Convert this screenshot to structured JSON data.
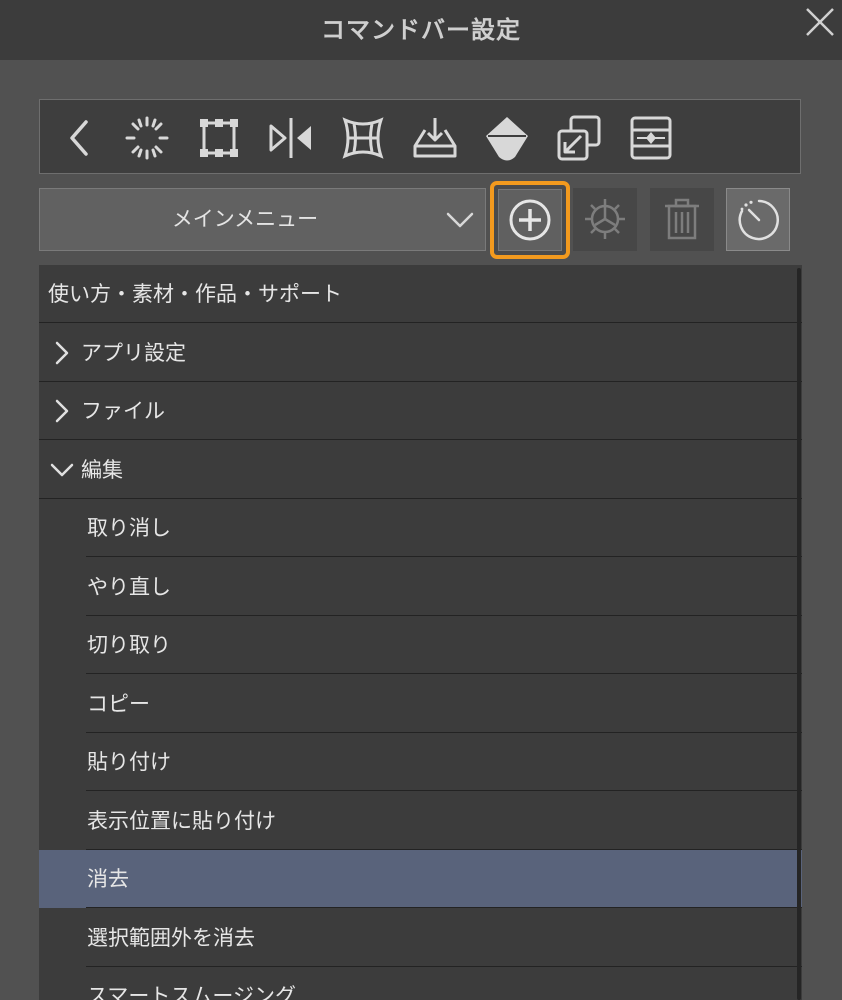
{
  "window": {
    "title": "コマンドバー設定"
  },
  "toolbar": {
    "icons": [
      "back-arrow-icon",
      "select-all-icon",
      "transform-icon",
      "flip-horizontal-icon",
      "mesh-transform-icon",
      "import-icon",
      "fill-icon",
      "duplicate-layer-icon",
      "layer-order-icon"
    ]
  },
  "menu_selector": {
    "label": "メインメニュー"
  },
  "list": {
    "items": [
      {
        "label": "使い方・素材・作品・サポート",
        "indent": 0,
        "arrow": "none",
        "selected": false
      },
      {
        "label": "アプリ設定",
        "indent": 1,
        "arrow": "right",
        "selected": false
      },
      {
        "label": "ファイル",
        "indent": 1,
        "arrow": "right",
        "selected": false
      },
      {
        "label": "編集",
        "indent": 1,
        "arrow": "down",
        "selected": false
      },
      {
        "label": "取り消し",
        "indent": 2,
        "arrow": "none",
        "selected": false
      },
      {
        "label": "やり直し",
        "indent": 2,
        "arrow": "none",
        "selected": false
      },
      {
        "label": "切り取り",
        "indent": 2,
        "arrow": "none",
        "selected": false
      },
      {
        "label": "コピー",
        "indent": 2,
        "arrow": "none",
        "selected": false
      },
      {
        "label": "貼り付け",
        "indent": 2,
        "arrow": "none",
        "selected": false
      },
      {
        "label": "表示位置に貼り付け",
        "indent": 2,
        "arrow": "none",
        "selected": false
      },
      {
        "label": "消去",
        "indent": 2,
        "arrow": "none",
        "selected": true
      },
      {
        "label": "選択範囲外を消去",
        "indent": 2,
        "arrow": "none",
        "selected": false
      },
      {
        "label": "スマートスムージング",
        "indent": 2,
        "arrow": "none",
        "selected": false
      }
    ]
  },
  "colors": {
    "accent_highlight": "#f39a1e",
    "selected_row": "#59637b",
    "background": "#515151",
    "list_background": "#3c3c3c"
  }
}
